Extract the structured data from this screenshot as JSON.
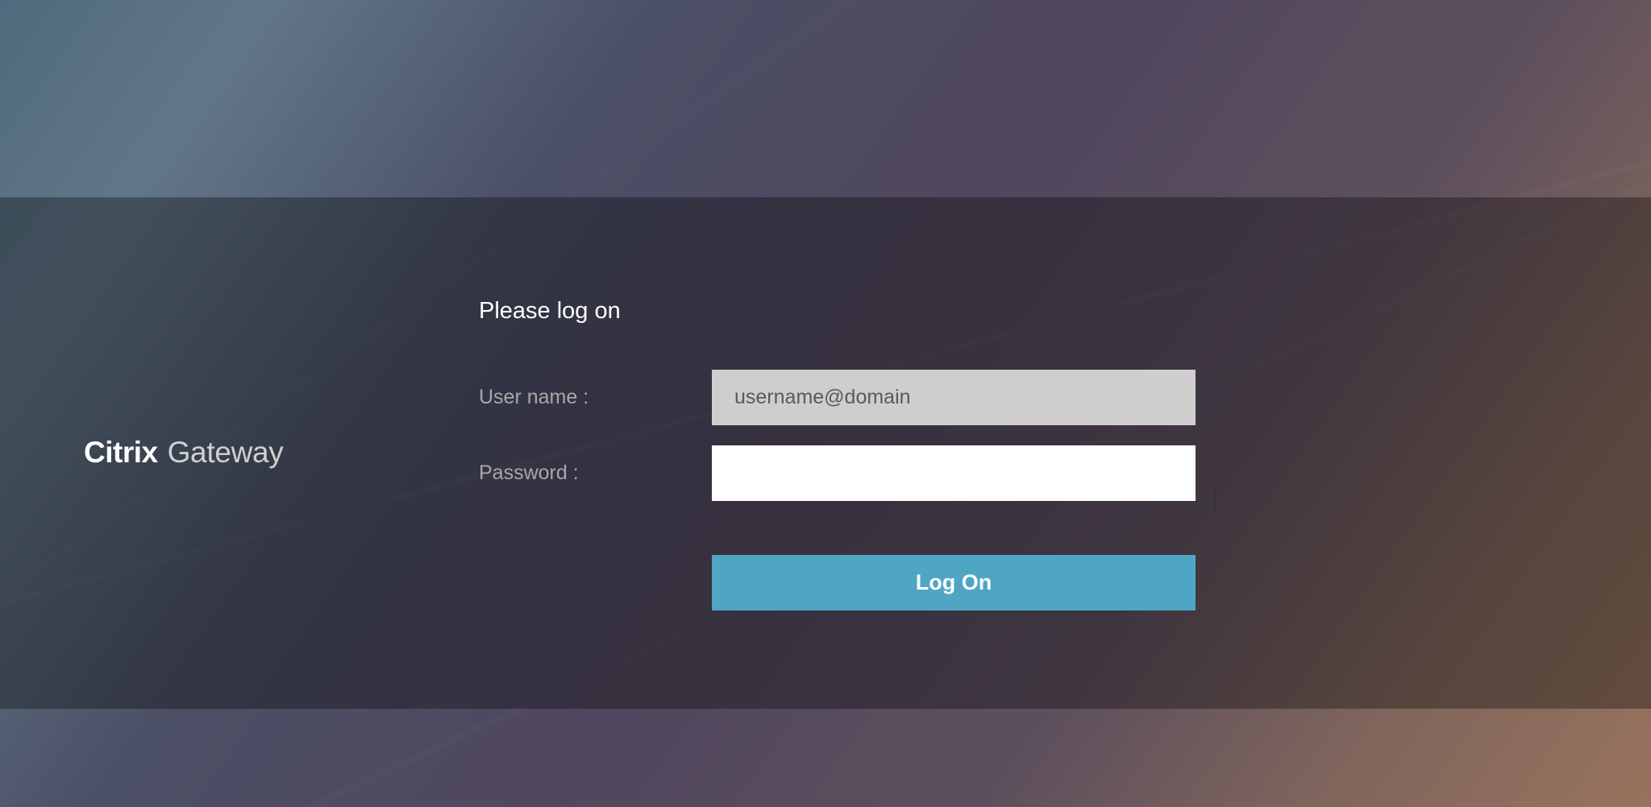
{
  "branding": {
    "name_bold": "Citrix",
    "name_light": "Gateway"
  },
  "form": {
    "title": "Please log on",
    "username_label": "User name :",
    "username_placeholder": "username@domain",
    "username_value": "",
    "password_label": "Password :",
    "password_value": "",
    "submit_label": "Log On"
  },
  "colors": {
    "accent": "#4fa6c4",
    "panel_overlay": "rgba(0,0,0,0.32)"
  }
}
